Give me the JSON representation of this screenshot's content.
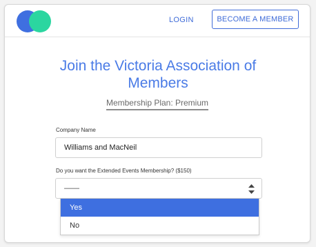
{
  "header": {
    "login_label": "LOGIN",
    "become_member_label": "BECOME A MEMBER",
    "logo_colors": [
      "#3f6fe0",
      "#2bd6a0"
    ]
  },
  "main": {
    "title": "Join the Victoria Association of Members",
    "plan": "Membership Plan: Premium"
  },
  "form": {
    "company": {
      "label": "Company Name",
      "value": "Williams and MacNeil"
    },
    "events": {
      "label": "Do you want the Extended Events Membership? ($150)",
      "value": "——",
      "options": [
        "Yes",
        "No"
      ],
      "highlighted": "Yes"
    }
  },
  "colors": {
    "accent": "#3e6bd8",
    "title": "#4a7be6",
    "highlight": "#3e6fe0"
  }
}
